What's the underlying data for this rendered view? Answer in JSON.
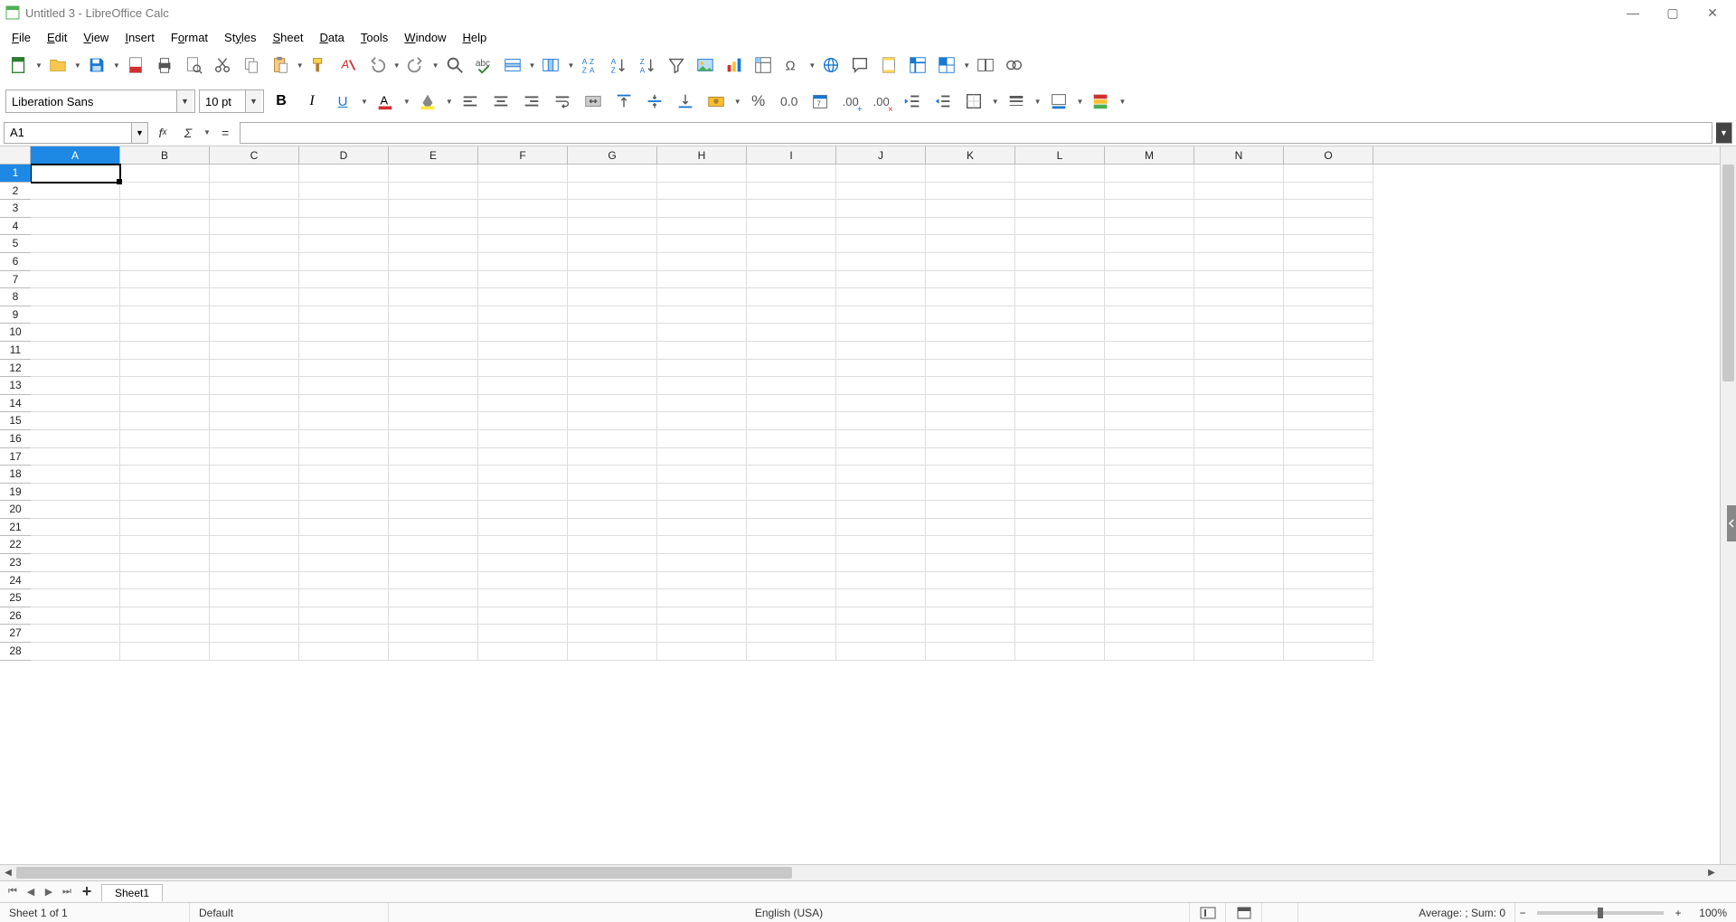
{
  "window": {
    "title": "Untitled 3 - LibreOffice Calc"
  },
  "menu": {
    "items": [
      "File",
      "Edit",
      "View",
      "Insert",
      "Format",
      "Styles",
      "Sheet",
      "Data",
      "Tools",
      "Window",
      "Help"
    ]
  },
  "toolbar2": {
    "font_name": "Liberation Sans",
    "font_size": "10 pt"
  },
  "formula_bar": {
    "cell_ref": "A1",
    "formula": ""
  },
  "sheet": {
    "columns": [
      "A",
      "B",
      "C",
      "D",
      "E",
      "F",
      "G",
      "H",
      "I",
      "J",
      "K",
      "L",
      "M",
      "N",
      "O"
    ],
    "row_count": 28,
    "active_cell": "A1",
    "tabs": [
      "Sheet1"
    ]
  },
  "status": {
    "sheet_info": "Sheet 1 of 1",
    "style": "Default",
    "language": "English (USA)",
    "summary": "Average: ; Sum: 0",
    "zoom": "100%"
  },
  "icons": {
    "minimize": "—",
    "maximize": "▢",
    "close": "✕"
  }
}
